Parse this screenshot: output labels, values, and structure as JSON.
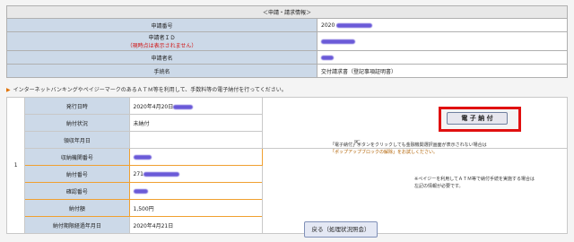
{
  "top": {
    "header": "＜申請・請求情報＞",
    "rows": [
      {
        "label": "申請番号",
        "value": "2020"
      },
      {
        "label": "申請者ＩＤ",
        "note": "（現時点は表示されません）",
        "value": ""
      },
      {
        "label": "申請者名",
        "value": ""
      },
      {
        "label": "手続名",
        "value": "交付請求書（登記事項証明書）"
      }
    ]
  },
  "notice": "インターネットバンキングやペイジーマークのあるＡＴＭ等を利用して、手数料等の電子納付を行ってください。",
  "main": {
    "row_number": "1",
    "rows": [
      {
        "label": "発行日時",
        "value": "2020年4月20日"
      },
      {
        "label": "納付状況",
        "value": "未納付"
      },
      {
        "label": "領収年月日",
        "value": ""
      },
      {
        "label": "収納機関番号",
        "value": ""
      },
      {
        "label": "納付番号",
        "value": "271"
      },
      {
        "label": "確認番号",
        "value": ""
      },
      {
        "label": "納付額",
        "value": "1,500円"
      },
      {
        "label": "納付期限経過年月日",
        "value": "2020年4月21日"
      }
    ],
    "pay_button": "電 子 納 付",
    "side_note_1": "「電子納付」ボタンをクリックしても金融機関選択画面が表示されない場合は",
    "side_note_1b": "「ポップアップブロックの解除」をお試しください。",
    "side_note_2": "※ペイジーを利用してＡＴＭ等で納付手続を実施する場合は",
    "side_note_2b": "左記の情報が必要です。"
  },
  "back_button": "戻る（処理状況照会）",
  "colors": {
    "label_bg": "#ccd9e8",
    "highlight": "#e01010",
    "orange_border": "#f0a030"
  }
}
